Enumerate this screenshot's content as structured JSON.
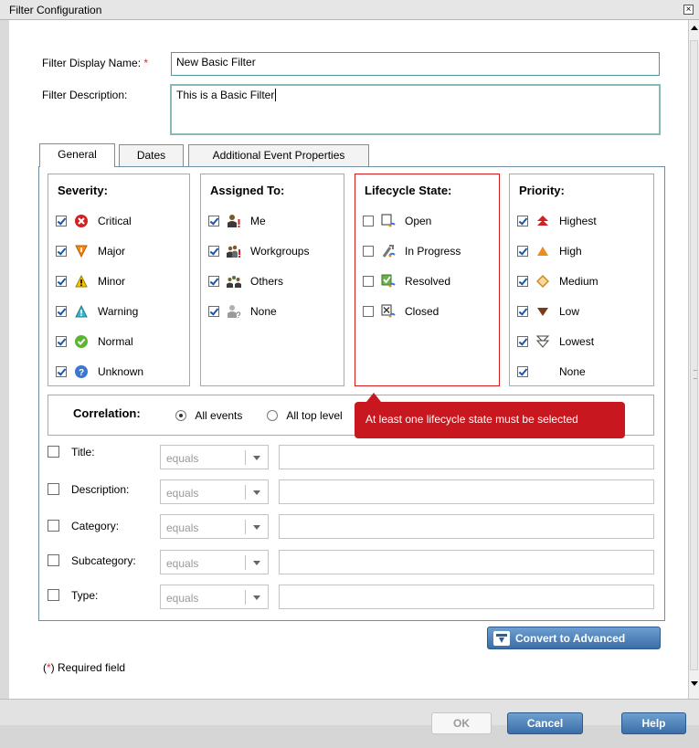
{
  "window": {
    "title": "Filter Configuration",
    "close_glyph": "×"
  },
  "form": {
    "display_name_label": "Filter Display Name:",
    "required_mark": "*",
    "display_name_value": "New Basic Filter",
    "description_label": "Filter Description:",
    "description_value": "This is a Basic Filter"
  },
  "tabs": [
    {
      "label": "General",
      "active": true
    },
    {
      "label": "Dates",
      "active": false
    },
    {
      "label": "Additional Event Properties",
      "active": false
    }
  ],
  "severity": {
    "title": "Severity:",
    "items": [
      {
        "label": "Critical",
        "checked": true,
        "icon": "critical-icon"
      },
      {
        "label": "Major",
        "checked": true,
        "icon": "major-icon"
      },
      {
        "label": "Minor",
        "checked": true,
        "icon": "minor-icon"
      },
      {
        "label": "Warning",
        "checked": true,
        "icon": "warning-icon"
      },
      {
        "label": "Normal",
        "checked": true,
        "icon": "normal-icon"
      },
      {
        "label": "Unknown",
        "checked": true,
        "icon": "unknown-icon"
      }
    ]
  },
  "assigned": {
    "title": "Assigned To:",
    "items": [
      {
        "label": "Me",
        "checked": true,
        "icon": "user-me-icon"
      },
      {
        "label": "Workgroups",
        "checked": true,
        "icon": "workgroups-icon"
      },
      {
        "label": "Others",
        "checked": true,
        "icon": "others-icon"
      },
      {
        "label": "None",
        "checked": true,
        "icon": "unassigned-icon"
      }
    ]
  },
  "lifecycle": {
    "title": "Lifecycle State:",
    "items": [
      {
        "label": "Open",
        "checked": false,
        "icon": "open-state-icon"
      },
      {
        "label": "In Progress",
        "checked": false,
        "icon": "in-progress-icon"
      },
      {
        "label": "Resolved",
        "checked": false,
        "icon": "resolved-icon"
      },
      {
        "label": "Closed",
        "checked": false,
        "icon": "closed-state-icon"
      }
    ]
  },
  "priority": {
    "title": "Priority:",
    "items": [
      {
        "label": "Highest",
        "checked": true,
        "icon": "priority-highest-icon"
      },
      {
        "label": "High",
        "checked": true,
        "icon": "priority-high-icon"
      },
      {
        "label": "Medium",
        "checked": true,
        "icon": "priority-medium-icon"
      },
      {
        "label": "Low",
        "checked": true,
        "icon": "priority-low-icon"
      },
      {
        "label": "Lowest",
        "checked": true,
        "icon": "priority-lowest-icon"
      },
      {
        "label": "None",
        "checked": true,
        "icon": ""
      }
    ]
  },
  "correlation": {
    "label": "Correlation:",
    "option_all": "All events",
    "option_top": "All top level",
    "selected": "All events"
  },
  "tooltip": {
    "text": "At least one lifecycle state must be selected"
  },
  "filters": [
    {
      "label": "Title:",
      "operator": "equals",
      "value": ""
    },
    {
      "label": "Description:",
      "operator": "equals",
      "value": ""
    },
    {
      "label": "Category:",
      "operator": "equals",
      "value": ""
    },
    {
      "label": "Subcategory:",
      "operator": "equals",
      "value": ""
    },
    {
      "label": "Type:",
      "operator": "equals",
      "value": ""
    }
  ],
  "convert_button": "Convert to Advanced",
  "required_note": {
    "mark_open": "(",
    "mark": "*",
    "mark_close": ")",
    "text": " Required field"
  },
  "buttons": {
    "ok": "OK",
    "cancel": "Cancel",
    "help": "Help"
  }
}
